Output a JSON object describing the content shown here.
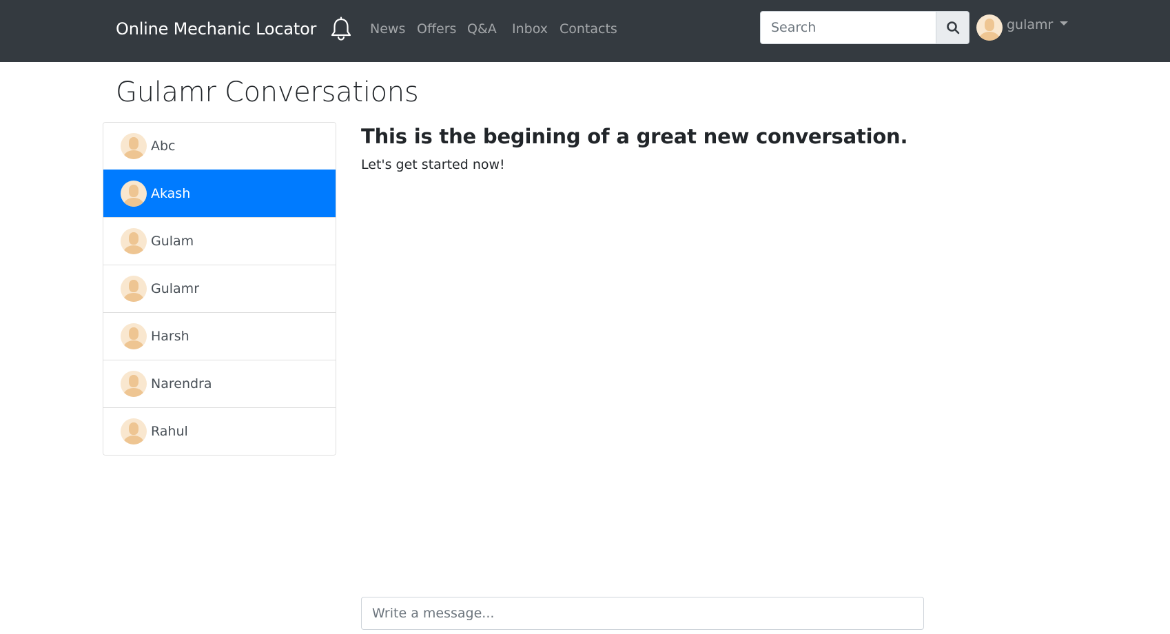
{
  "navbar": {
    "brand": "Online Mechanic Locator",
    "links": [
      "News",
      "Offers",
      "Q&A",
      "Inbox",
      "Contacts"
    ],
    "search_placeholder": "Search",
    "user_name": "gulamr"
  },
  "page": {
    "title": "Gulamr Conversations"
  },
  "contacts": [
    {
      "name": "Abc",
      "active": false
    },
    {
      "name": "Akash",
      "active": true
    },
    {
      "name": "Gulam",
      "active": false
    },
    {
      "name": "Gulamr",
      "active": false
    },
    {
      "name": "Harsh",
      "active": false
    },
    {
      "name": "Narendra",
      "active": false
    },
    {
      "name": "Rahul",
      "active": false
    }
  ],
  "conversation": {
    "heading": "This is the begining of a great new conversation.",
    "subtext": "Let's get started now!",
    "message_placeholder": "Write a message..."
  },
  "colors": {
    "navbar_bg": "#343a40",
    "active_item_bg": "#007bff"
  },
  "icons": {
    "bell": "bell-icon",
    "search": "search-icon",
    "avatar": "avatar-icon",
    "caret": "caret-down-icon"
  }
}
